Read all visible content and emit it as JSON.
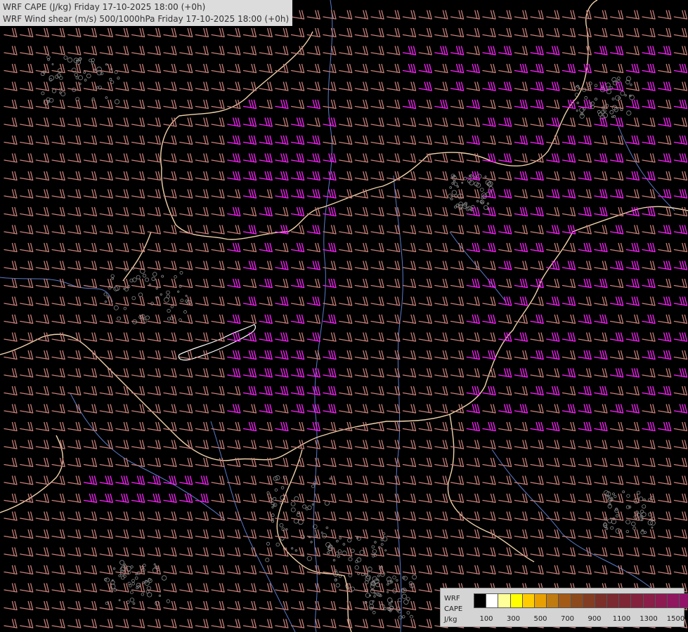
{
  "title_lines": [
    "WRF CAPE (J/kg) Friday 17-10-2025 18:00 (+0h)",
    "WRF Wind shear (m/s) 500/1000hPa Friday 17-10-2025 18:00 (+0h)"
  ],
  "legend": {
    "line1": "WRF",
    "line2": "CAPE",
    "line3": "J/kg",
    "swatch_colors": [
      "#000000",
      "#ffffff",
      "#ffff99",
      "#ffff00",
      "#ffcc00",
      "#e8a000",
      "#bf7a10",
      "#a25a16",
      "#8c4a1c",
      "#823c22",
      "#7a3028",
      "#7a2a30",
      "#7e2636",
      "#84223e",
      "#8a1e48",
      "#8e1a52",
      "#901660",
      "#92126a"
    ],
    "tick_labels": [
      "100",
      "300",
      "500",
      "700",
      "900",
      "1100",
      "1300",
      "1500"
    ]
  },
  "colors": {
    "barb_weak": "#c8807a",
    "barb_strong": "#ff20ff",
    "border": "#f0d2aa",
    "river": "#5a7ac8",
    "terrain": "#8a8a8a"
  }
}
